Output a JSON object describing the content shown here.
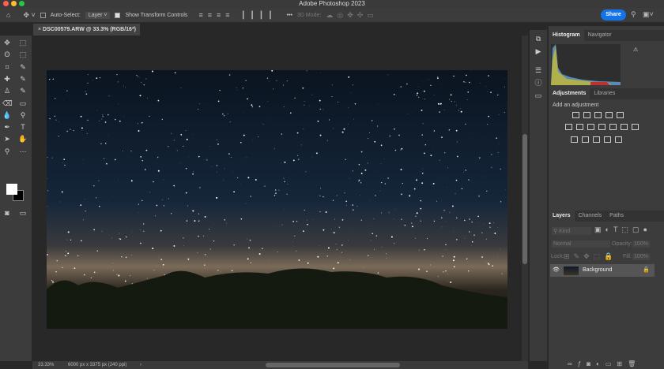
{
  "app": {
    "title": "Adobe Photoshop 2023"
  },
  "options": {
    "auto_select_label": "Auto-Select:",
    "auto_select_value": "Layer",
    "show_transform_label": "Show Transform Controls",
    "mode_3d": "3D Mode:",
    "share": "Share",
    "more": "•••"
  },
  "document": {
    "tab": "DSC00579.ARW @ 33.3% (RGB/16*)",
    "close": "×"
  },
  "status": {
    "zoom": "33.33%",
    "dimensions": "6000 px x 3375 px (240 ppi)",
    "arrow": "›"
  },
  "panels": {
    "histogram_tabs": [
      "Histogram",
      "Navigator"
    ],
    "adjustments_tabs": [
      "Adjustments",
      "Libraries"
    ],
    "add_adjustment": "Add an adjustment",
    "layers_tabs": [
      "Layers",
      "Channels",
      "Paths"
    ],
    "kind": "Kind",
    "blend_mode": "Normal",
    "opacity_label": "Opacity:",
    "opacity": "100%",
    "lock_label": "Lock:",
    "fill_label": "Fill:",
    "fill": "100%",
    "layers": [
      {
        "name": "Background",
        "visible": true,
        "locked": true
      }
    ],
    "warning": "⚠"
  },
  "colors": {
    "accent": "#1473e6",
    "foreground": "#ffffff",
    "background": "#000000"
  }
}
